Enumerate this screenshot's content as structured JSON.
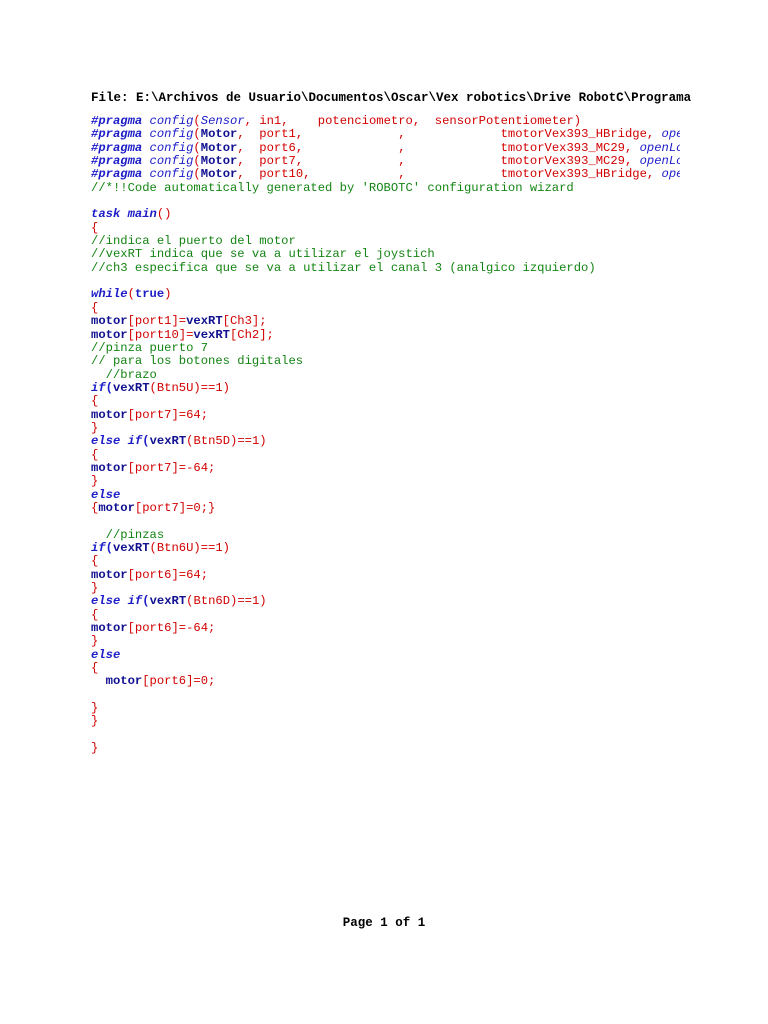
{
  "document": {
    "file_path": "File: E:\\Archivos de Usuario\\Documentos\\Oscar\\Vex robotics\\Drive RobotC\\Programa",
    "footer": "Page 1 of 1"
  },
  "code_lines": [
    [
      [
        "kw",
        "#pragma"
      ],
      [
        "red",
        " "
      ],
      [
        "fn",
        "config"
      ],
      [
        "br2",
        "("
      ],
      [
        "fn",
        "Sensor"
      ],
      [
        "red",
        ", in1,    potenciometro,  sensorPotentiometer)"
      ]
    ],
    [
      [
        "kw",
        "#pragma"
      ],
      [
        "red",
        " "
      ],
      [
        "fn",
        "config"
      ],
      [
        "br2",
        "("
      ],
      [
        "id",
        "Motor"
      ],
      [
        "red",
        ",  port1,             ,             tmotorVex393_HBridge, "
      ],
      [
        "fn",
        "openLoop"
      ]
    ],
    [
      [
        "kw",
        "#pragma"
      ],
      [
        "red",
        " "
      ],
      [
        "fn",
        "config"
      ],
      [
        "br2",
        "("
      ],
      [
        "id",
        "Motor"
      ],
      [
        "red",
        ",  port6,             ,             tmotorVex393_MC29, "
      ],
      [
        "fn",
        "openLoop"
      ]
    ],
    [
      [
        "kw",
        "#pragma"
      ],
      [
        "red",
        " "
      ],
      [
        "fn",
        "config"
      ],
      [
        "br2",
        "("
      ],
      [
        "id",
        "Motor"
      ],
      [
        "red",
        ",  port7,             ,             tmotorVex393_MC29, "
      ],
      [
        "fn",
        "openLoop"
      ]
    ],
    [
      [
        "kw",
        "#pragma"
      ],
      [
        "red",
        " "
      ],
      [
        "fn",
        "config"
      ],
      [
        "br2",
        "("
      ],
      [
        "id",
        "Motor"
      ],
      [
        "red",
        ",  port10,            ,             tmotorVex393_HBridge, "
      ],
      [
        "fn",
        "openLoop"
      ]
    ],
    [
      [
        "cm",
        "//*!!Code automatically generated by 'ROBOTC' configuration wizard"
      ]
    ],
    [],
    [
      [
        "kw",
        "task"
      ],
      [
        "red",
        " "
      ],
      [
        "kw",
        "main"
      ],
      [
        "br2",
        "()"
      ]
    ],
    [
      [
        "br2",
        "{"
      ]
    ],
    [
      [
        "cm",
        "//indica el puerto del motor"
      ]
    ],
    [
      [
        "cm",
        "//vexRT indica que se va a utilizar el joystich"
      ]
    ],
    [
      [
        "cm",
        "//ch3 especifica que se va a utilizar el canal 3 (analgico izquierdo)"
      ]
    ],
    [],
    [
      [
        "kw",
        "while"
      ],
      [
        "br2",
        "("
      ],
      [
        "lit",
        "true"
      ],
      [
        "br2",
        ")"
      ]
    ],
    [
      [
        "br2",
        "{"
      ]
    ],
    [
      [
        "id",
        "motor"
      ],
      [
        "red",
        "[port1]="
      ],
      [
        "id",
        "vexRT"
      ],
      [
        "red",
        "[Ch3];"
      ]
    ],
    [
      [
        "id",
        "motor"
      ],
      [
        "red",
        "[port10]="
      ],
      [
        "id",
        "vexRT"
      ],
      [
        "red",
        "[Ch2];"
      ]
    ],
    [
      [
        "cm",
        "//pinza puerto 7"
      ]
    ],
    [
      [
        "cm",
        "// para los botones digitales"
      ]
    ],
    [
      [
        "cm",
        "  //brazo"
      ]
    ],
    [
      [
        "kw",
        "if"
      ],
      [
        "br",
        "("
      ],
      [
        "id",
        "vexRT"
      ],
      [
        "red",
        "(Btn5U)==1)"
      ]
    ],
    [
      [
        "br2",
        "{"
      ]
    ],
    [
      [
        "id",
        "motor"
      ],
      [
        "red",
        "[port7]=64;"
      ]
    ],
    [
      [
        "br2",
        "}"
      ]
    ],
    [
      [
        "kw",
        "else"
      ],
      [
        "red",
        " "
      ],
      [
        "kw",
        "if"
      ],
      [
        "br",
        "("
      ],
      [
        "id",
        "vexRT"
      ],
      [
        "red",
        "(Btn5D)==1)"
      ]
    ],
    [
      [
        "br2",
        "{"
      ]
    ],
    [
      [
        "id",
        "motor"
      ],
      [
        "red",
        "[port7]=-64;"
      ]
    ],
    [
      [
        "br2",
        "}"
      ]
    ],
    [
      [
        "kw",
        "else"
      ]
    ],
    [
      [
        "br2",
        "{"
      ],
      [
        "id",
        "motor"
      ],
      [
        "red",
        "[port7]=0;}"
      ]
    ],
    [],
    [
      [
        "cm",
        "  //pinzas"
      ]
    ],
    [
      [
        "kw",
        "if"
      ],
      [
        "br",
        "("
      ],
      [
        "id",
        "vexRT"
      ],
      [
        "red",
        "(Btn6U)==1)"
      ]
    ],
    [
      [
        "br2",
        "{"
      ]
    ],
    [
      [
        "id",
        "motor"
      ],
      [
        "red",
        "[port6]=64;"
      ]
    ],
    [
      [
        "br2",
        "}"
      ]
    ],
    [
      [
        "kw",
        "else"
      ],
      [
        "red",
        " "
      ],
      [
        "kw",
        "if"
      ],
      [
        "br",
        "("
      ],
      [
        "id",
        "vexRT"
      ],
      [
        "red",
        "(Btn6D)==1)"
      ]
    ],
    [
      [
        "br2",
        "{"
      ]
    ],
    [
      [
        "id",
        "motor"
      ],
      [
        "red",
        "[port6]=-64;"
      ]
    ],
    [
      [
        "br2",
        "}"
      ]
    ],
    [
      [
        "kw",
        "else"
      ]
    ],
    [
      [
        "br2",
        "{"
      ]
    ],
    [
      [
        "red",
        "  "
      ],
      [
        "id",
        "motor"
      ],
      [
        "red",
        "[port6]=0;"
      ]
    ],
    [],
    [
      [
        "br2",
        "}"
      ]
    ],
    [
      [
        "br2",
        "}"
      ]
    ],
    [],
    [
      [
        "br2",
        "}"
      ]
    ]
  ],
  "colors": {
    "keyword": "#1c1cc8",
    "identifier": "#101090",
    "punctuation": "#d20000",
    "comment": "#138413",
    "text": "#000000",
    "background": "#ffffff"
  }
}
